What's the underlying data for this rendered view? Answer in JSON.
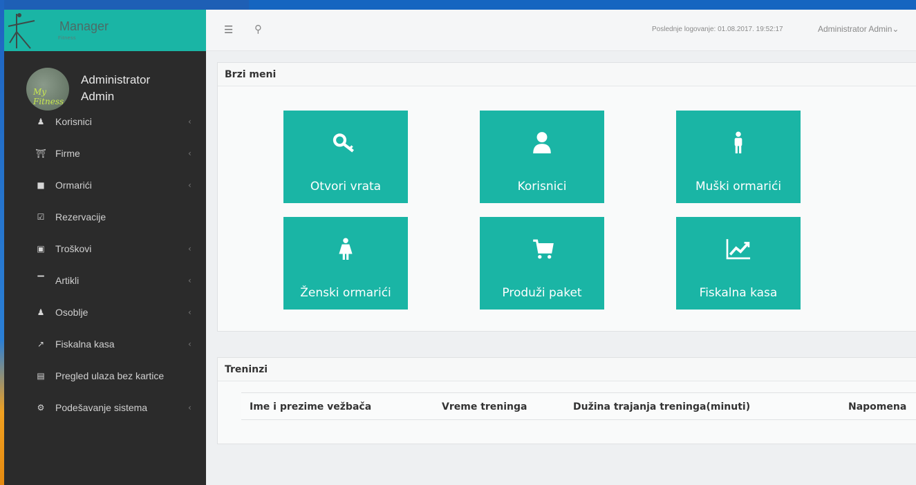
{
  "brand": {
    "name": "Manager",
    "sub": "Fitness"
  },
  "user": {
    "name_line1": "Administrator",
    "name_line2": "Admin",
    "avatar_text": "My Fitness"
  },
  "sidebar": {
    "items": [
      {
        "label": "Korisnici",
        "icon": "user-icon",
        "has_chevron": true
      },
      {
        "label": "Firme",
        "icon": "bank-icon",
        "has_chevron": true
      },
      {
        "label": "Ormarići",
        "icon": "lock-icon",
        "has_chevron": true
      },
      {
        "label": "Rezervacije",
        "icon": "check-square-icon",
        "has_chevron": false
      },
      {
        "label": "Troškovi",
        "icon": "money-icon",
        "has_chevron": true
      },
      {
        "label": "Artikli",
        "icon": "cart-icon",
        "has_chevron": true
      },
      {
        "label": "Osoblje",
        "icon": "users-icon",
        "has_chevron": true
      },
      {
        "label": "Fiskalna kasa",
        "icon": "line-chart-icon",
        "has_chevron": true
      },
      {
        "label": "Pregled ulaza bez kartice",
        "icon": "file-icon",
        "has_chevron": false
      },
      {
        "label": "Podešavanje sistema",
        "icon": "cogs-icon",
        "has_chevron": true
      }
    ]
  },
  "topbar": {
    "last_login": "Poslednje logovanje: 01.08.2017. 19:52:17",
    "admin_label": "Administrator Admin"
  },
  "quick_menu": {
    "title": "Brzi meni",
    "tiles": [
      {
        "label": "Otvori vrata",
        "icon": "key-icon"
      },
      {
        "label": "Korisnici",
        "icon": "user-icon"
      },
      {
        "label": "Muški ormarići",
        "icon": "male-icon"
      },
      {
        "label": "Ženski ormarići",
        "icon": "female-icon"
      },
      {
        "label": "Produži paket",
        "icon": "cart-icon"
      },
      {
        "label": "Fiskalna kasa",
        "icon": "line-chart-icon"
      }
    ]
  },
  "trainings": {
    "title": "Treninzi",
    "columns": [
      "Ime i prezime vežbača",
      "Vreme treninga",
      "Dužina trajanja treninga(minuti)",
      "Napomena"
    ]
  },
  "colors": {
    "accent": "#1ab5a5",
    "sidebar_bg": "#2b2b2b",
    "topbar_bg": "#f5f6f7"
  }
}
